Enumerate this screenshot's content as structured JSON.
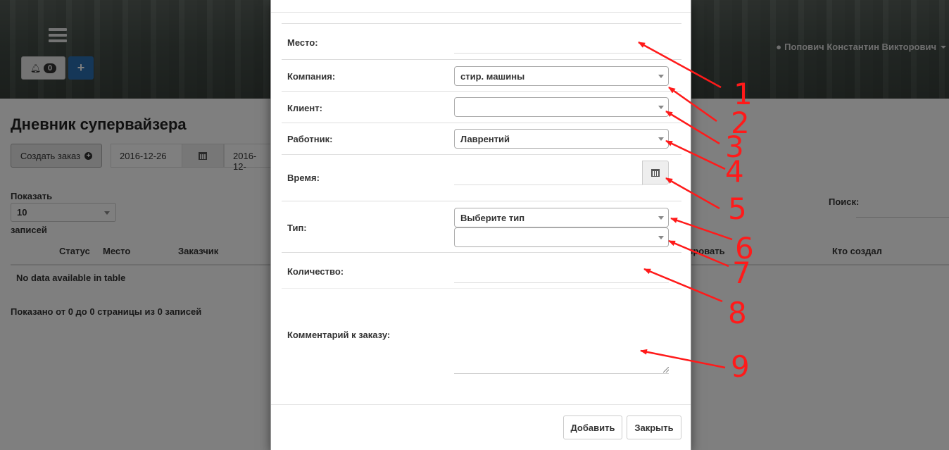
{
  "header": {
    "notification_count": "0",
    "add_symbol": "+",
    "user_name": "Попович Константин Викторович"
  },
  "page": {
    "title": "Дневник супервайзера",
    "create_order_label": "Создать заказ",
    "date_from": "2016-12-26",
    "date_to": "2016-12-",
    "show_label": "Показать",
    "page_length": "10",
    "records_label": "записей",
    "search_label": "Поиск:",
    "columns": {
      "status": "Статус",
      "place": "Место",
      "customer": "Заказчик",
      "edit_partial": "тировать",
      "creator": "Кто создал"
    },
    "no_data": "No data available in table",
    "info": "Показано от 0 до 0 страницы из 0 записей"
  },
  "modal": {
    "fields": {
      "place_label": "Место:",
      "company_label": "Компания:",
      "company_value": "стир. машины",
      "client_label": "Клиент:",
      "client_value": "",
      "worker_label": "Работник:",
      "worker_value": "Лаврентий",
      "time_label": "Время:",
      "type_label": "Тип:",
      "type_value": "Выберите тип",
      "subtype_value": "",
      "quantity_label": "Количество:",
      "comment_label": "Комментарий к заказу:"
    },
    "buttons": {
      "add": "Добавить",
      "close": "Закрыть"
    }
  },
  "annotations": [
    "1",
    "2",
    "3",
    "4",
    "5",
    "6",
    "7",
    "8",
    "9"
  ],
  "colors": {
    "annotation": "#ff1a1a",
    "primary_button": "#2a6fb0"
  }
}
